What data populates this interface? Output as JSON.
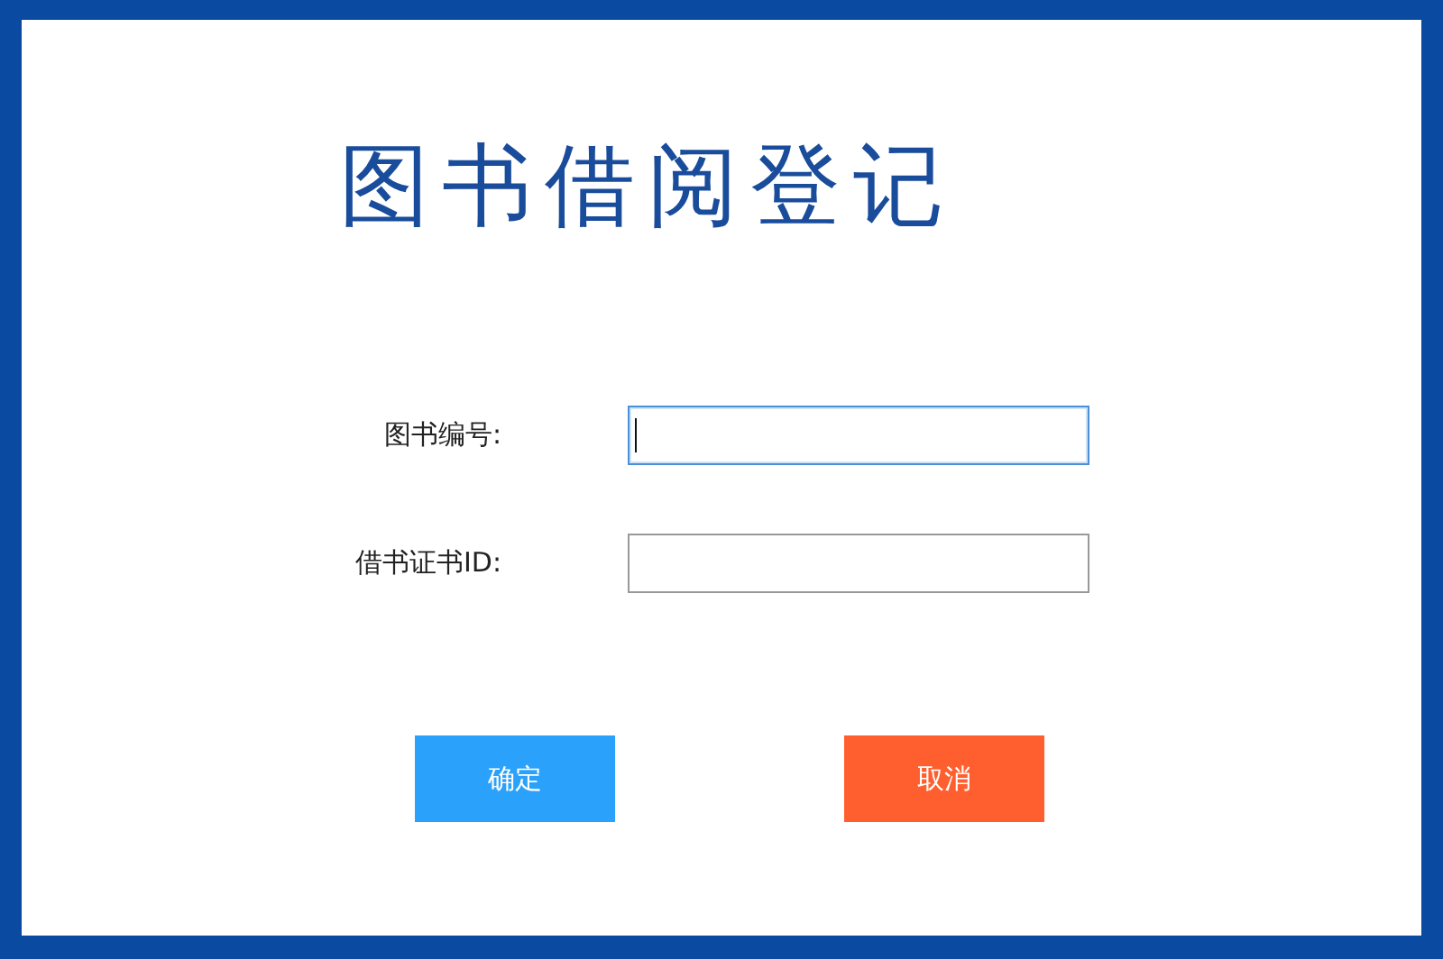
{
  "title": "图书借阅登记",
  "fields": [
    {
      "label": "图书编号:",
      "focused": true
    },
    {
      "label": "借书证书ID:",
      "focused": false
    }
  ],
  "buttons": [
    {
      "label": "确定",
      "kind": "primary"
    },
    {
      "label": "取消",
      "kind": "danger"
    }
  ]
}
